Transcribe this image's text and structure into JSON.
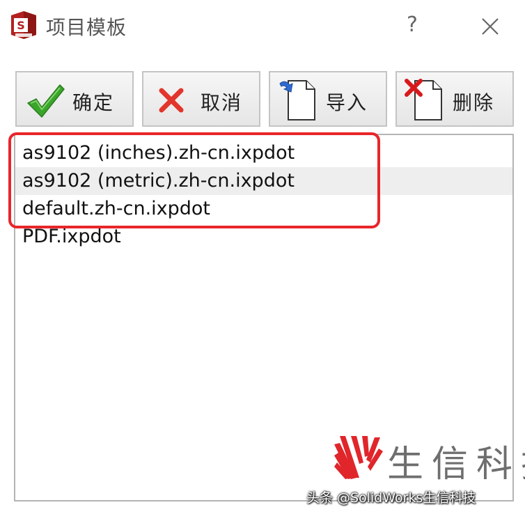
{
  "window": {
    "title": "项目模板",
    "help_label": "?",
    "app_icon_letters": "S"
  },
  "toolbar": {
    "ok_label": "确定",
    "cancel_label": "取消",
    "import_label": "导入",
    "delete_label": "删除"
  },
  "list": {
    "items": [
      "as9102 (inches).zh-cn.ixpdot",
      "as9102 (metric).zh-cn.ixpdot",
      "default.zh-cn.ixpdot",
      "PDF.ixpdot"
    ],
    "hovered_index": 1
  },
  "annotation": {
    "highlight_color": "#e8262b"
  },
  "watermark": {
    "brand": "生信科技",
    "credit": "头条 @SolidWorks生信科技"
  },
  "colors": {
    "check_green": "#3aa52a",
    "cross_red": "#e2352b",
    "delete_red": "#d8191c",
    "import_blue": "#2f6bd0",
    "brand_red": "#e0262b"
  }
}
